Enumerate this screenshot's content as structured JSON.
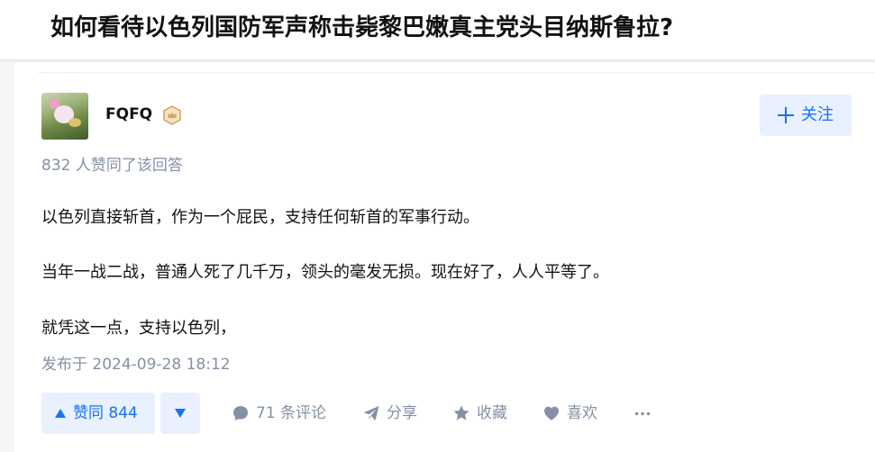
{
  "question": {
    "title": "如何看待以色列国防军声称击毙黎巴嫩真主党头目纳斯鲁拉?"
  },
  "answer": {
    "author": {
      "name": "FQFQ",
      "badge": "crown-badge-icon"
    },
    "follow_label": "关注",
    "upvote_summary": "832 人赞同了该回答",
    "paragraphs": [
      "以色列直接斩首，作为一个屁民，支持任何斩首的军事行动。",
      "当年一战二战，普通人死了几千万，领头的毫发无损。现在好了，人人平等了。",
      "就凭这一点，支持以色列，"
    ],
    "publish_time": "发布于 2024-09-28 18:12",
    "actions": {
      "vote_up_label": "赞同 844",
      "comment_label": "71 条评论",
      "share_label": "分享",
      "collect_label": "收藏",
      "like_label": "喜欢",
      "more_label": "···"
    }
  },
  "colors": {
    "accent": "#1772f6",
    "accent_bg": "#e8f1fd",
    "muted_text": "#8590a6",
    "body_text": "#121212",
    "badge": "#d4a35a"
  }
}
